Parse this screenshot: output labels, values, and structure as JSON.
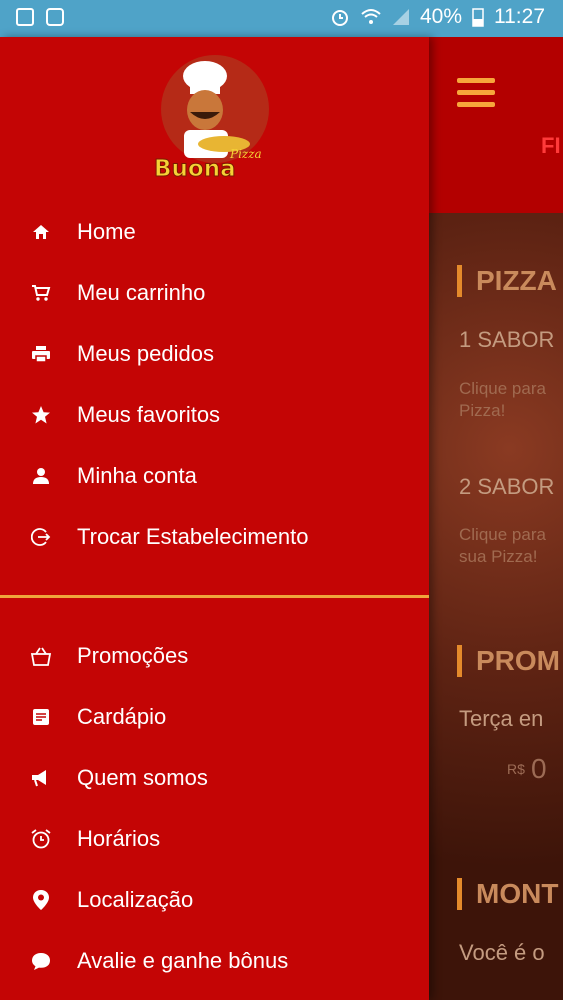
{
  "status_bar": {
    "battery": "40%",
    "time": "11:27"
  },
  "brand": {
    "logo_text": "Buona",
    "logo_sub": "Pizza"
  },
  "menu": {
    "primary": [
      {
        "label": "Home",
        "icon": "home-icon"
      },
      {
        "label": "Meu carrinho",
        "icon": "cart-icon"
      },
      {
        "label": "Meus pedidos",
        "icon": "printer-icon"
      },
      {
        "label": "Meus favoritos",
        "icon": "star-icon"
      },
      {
        "label": "Minha conta",
        "icon": "person-icon"
      },
      {
        "label": "Trocar Estabelecimento",
        "icon": "switch-icon"
      }
    ],
    "secondary": [
      {
        "label": "Promoções",
        "icon": "bag-icon"
      },
      {
        "label": "Cardápio",
        "icon": "menu-card-icon"
      },
      {
        "label": "Quem somos",
        "icon": "megaphone-icon"
      },
      {
        "label": "Horários",
        "icon": "alarm-icon"
      },
      {
        "label": "Localização",
        "icon": "location-pin-icon"
      },
      {
        "label": "Avalie e ganhe bônus",
        "icon": "chat-bubble-icon"
      }
    ]
  },
  "background": {
    "header_tag": "FI",
    "section1": "PIZZA",
    "line1": "1 SABOR",
    "line1_sub": "Clique para\nPizza!",
    "line2": "2 SABOR",
    "line2_sub": "Clique para\nsua Pizza!",
    "section2": "PROM",
    "promo_line": "Terça en",
    "promo_price_label": "R$",
    "promo_price": "0",
    "section3": "MONT",
    "bottom_line": "Você é o"
  },
  "colors": {
    "drawer_bg": "#c40505",
    "divider": "#f0a63c",
    "status_bar": "#4fa3c8",
    "accent": "#f7a63b"
  }
}
